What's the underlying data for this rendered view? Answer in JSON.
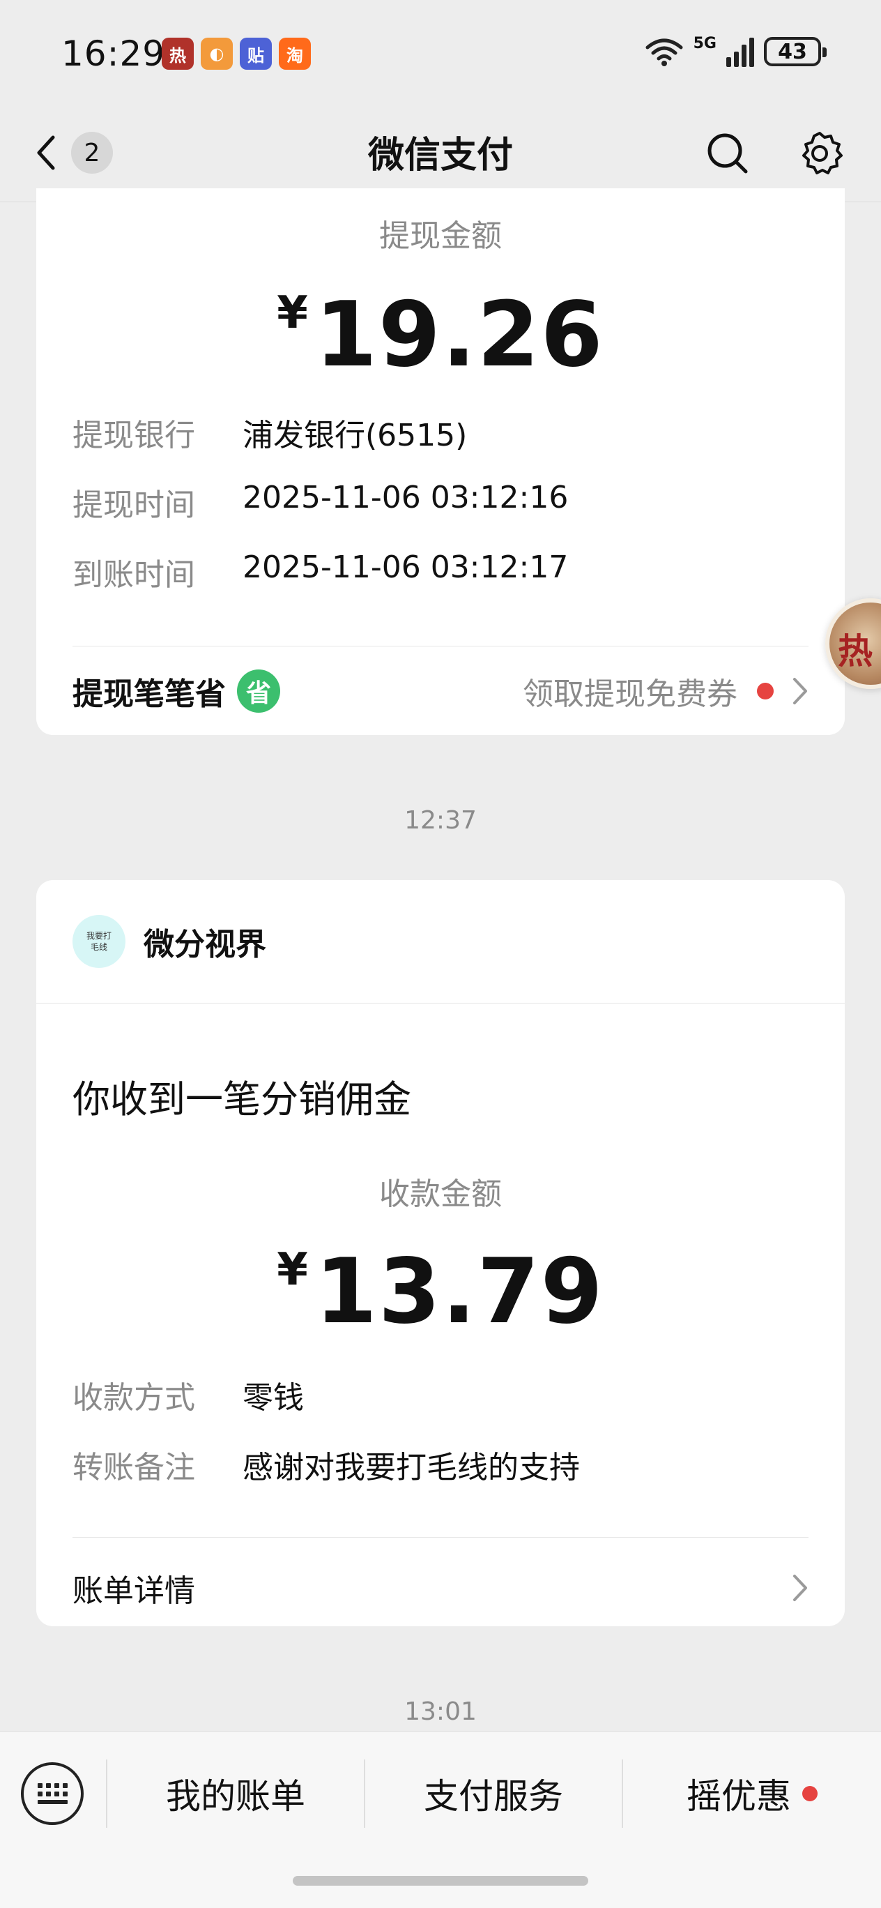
{
  "status_bar": {
    "time": "16:29",
    "network": "5G",
    "battery": "43",
    "app_icons": [
      {
        "label": "热",
        "color": "#b0322a"
      },
      {
        "label": "◐",
        "color": "#f39a3b"
      },
      {
        "label": "贴",
        "color": "#4d62d6"
      },
      {
        "label": "淘",
        "color": "#ff6a1a"
      }
    ]
  },
  "nav": {
    "title": "微信支付",
    "unread_count": "2"
  },
  "withdraw_card": {
    "amount_label": "提现金额",
    "currency": "¥",
    "amount": "19.26",
    "rows": [
      {
        "key": "提现银行",
        "value": "浦发银行(6515)"
      },
      {
        "key": "提现时间",
        "value": "2025-11-06 03:12:16"
      },
      {
        "key": "到账时间",
        "value": "2025-11-06 03:12:17"
      }
    ],
    "promo_title": "提现笔笔省",
    "promo_badge": "省",
    "promo_link": "领取提现免费券"
  },
  "timestamps": [
    "12:37",
    "13:01"
  ],
  "commission_card": {
    "merchant_name": "微分视界",
    "avatar_text_line1": "我要打",
    "avatar_text_line2": "毛线",
    "notice_title": "你收到一笔分销佣金",
    "amount_label": "收款金额",
    "currency": "¥",
    "amount": "13.79",
    "rows": [
      {
        "key": "收款方式",
        "value": "零钱"
      },
      {
        "key": "转账备注",
        "value": "感谢对我要打毛线的支持"
      }
    ],
    "bill_link": "账单详情"
  },
  "floating_badge": "热",
  "bottom_bar": {
    "tabs": [
      "我的账单",
      "支付服务",
      "摇优惠"
    ]
  },
  "colors": {
    "background": "#ededed",
    "card": "#ffffff",
    "accent_green": "#3cbf6e",
    "red_dot": "#e64340",
    "secondary_text": "#8a8a8a"
  }
}
